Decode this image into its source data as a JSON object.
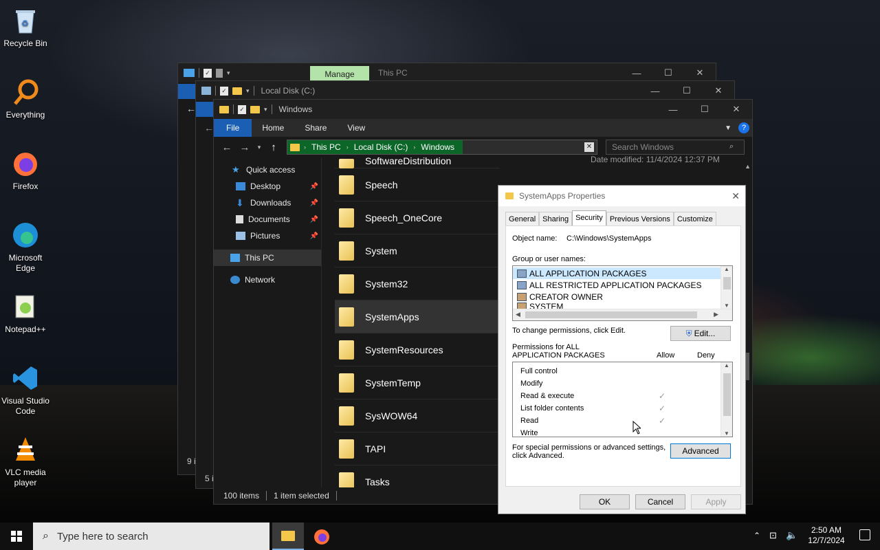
{
  "desktop": {
    "icons": [
      {
        "label": "Recycle Bin",
        "icon": "recycle-bin-icon"
      },
      {
        "label": "Everything",
        "icon": "everything-search-icon"
      },
      {
        "label": "Firefox",
        "icon": "firefox-icon"
      },
      {
        "label": "Microsoft Edge",
        "icon": "edge-icon"
      },
      {
        "label": "Notepad++",
        "icon": "notepadpp-icon"
      },
      {
        "label": "Visual Studio Code",
        "icon": "vscode-icon"
      },
      {
        "label": "VLC media player",
        "icon": "vlc-icon"
      }
    ]
  },
  "window1": {
    "manage_tab": "Manage",
    "title": "This PC",
    "status": "9 i"
  },
  "window2": {
    "title": "Local Disk (C:)",
    "status": "5 i"
  },
  "explorer": {
    "title": "Windows",
    "ribbon_tabs": [
      "File",
      "Home",
      "Share",
      "View"
    ],
    "breadcrumb": [
      "This PC",
      "Local Disk (C:)",
      "Windows"
    ],
    "search_placeholder": "Search Windows",
    "nav": {
      "quick_access": "Quick access",
      "desktop": "Desktop",
      "downloads": "Downloads",
      "documents": "Documents",
      "pictures": "Pictures",
      "this_pc": "This PC",
      "network": "Network"
    },
    "partial_top": "SoftwareDistribution",
    "partial_date": "Date modified: 11/4/2024 12:37 PM",
    "files": [
      "Speech",
      "Speech_OneCore",
      "System",
      "System32",
      "SystemApps",
      "SystemResources",
      "SystemTemp",
      "SysWOW64",
      "TAPI",
      "Tasks"
    ],
    "selected_file": "SystemApps",
    "status": {
      "items": "100 items",
      "selected": "1 item selected"
    }
  },
  "dialog": {
    "title": "SystemApps Properties",
    "tabs": [
      "General",
      "Sharing",
      "Security",
      "Previous Versions",
      "Customize"
    ],
    "active_tab": "Security",
    "object_label": "Object name:",
    "object_value": "C:\\Windows\\SystemApps",
    "group_label": "Group or user names:",
    "users": [
      "ALL APPLICATION PACKAGES",
      "ALL RESTRICTED APPLICATION PACKAGES",
      "CREATOR OWNER",
      "SYSTEM"
    ],
    "change_text": "To change permissions, click Edit.",
    "edit_btn": "Edit...",
    "perm_label_1": "Permissions for ALL",
    "perm_label_2": "APPLICATION PACKAGES",
    "allow": "Allow",
    "deny": "Deny",
    "permissions": [
      {
        "name": "Full control",
        "allow": ""
      },
      {
        "name": "Modify",
        "allow": ""
      },
      {
        "name": "Read & execute",
        "allow": "✓"
      },
      {
        "name": "List folder contents",
        "allow": "✓"
      },
      {
        "name": "Read",
        "allow": "✓"
      },
      {
        "name": "Write",
        "allow": ""
      }
    ],
    "special_1": "For special permissions or advanced settings,",
    "special_2": "click Advanced.",
    "advanced_btn": "Advanced",
    "ok": "OK",
    "cancel": "Cancel",
    "apply": "Apply"
  },
  "taskbar": {
    "search_placeholder": "Type here to search",
    "time": "2:50 AM",
    "date": "12/7/2024"
  }
}
